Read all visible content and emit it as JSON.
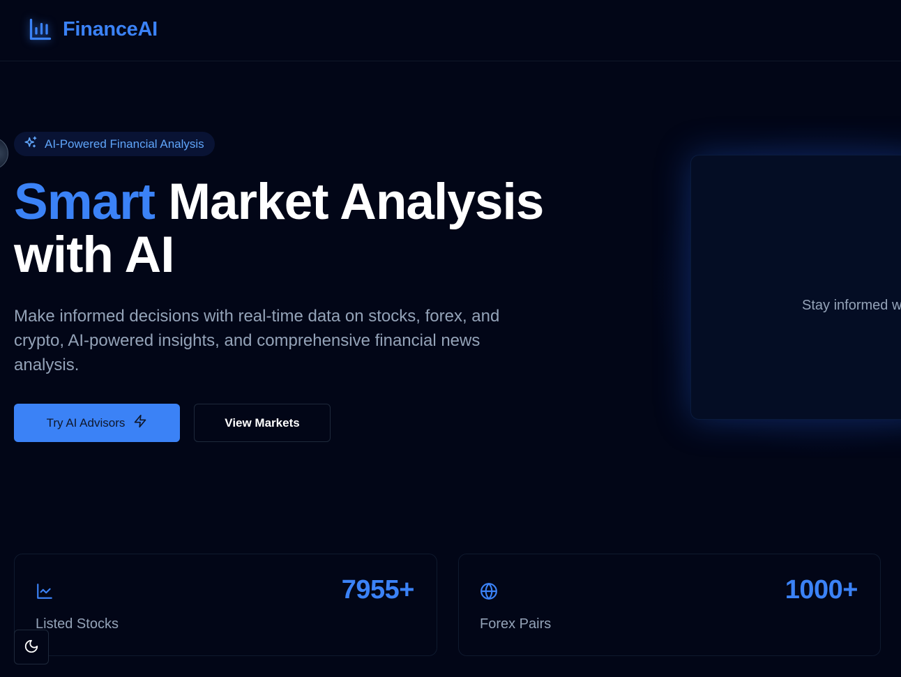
{
  "brand": {
    "name": "FinanceAI",
    "icon": "bar-chart-icon"
  },
  "hero": {
    "badge": {
      "icon": "sparkles-icon",
      "text": "AI-Powered Financial Analysis"
    },
    "title_accent": "Smart",
    "title_line1_rest": " Market Analysis",
    "title_line2": "with AI",
    "subtitle": "Make informed decisions with real-time data on stocks, forex, and crypto, AI-powered insights, and comprehensive financial news analysis.",
    "primary_button": {
      "label": "Try AI Advisors",
      "icon": "zap-icon"
    },
    "secondary_button": {
      "label": "View Markets"
    }
  },
  "preview_panel": {
    "text": "Stay informed w"
  },
  "stats": [
    {
      "icon": "line-chart-icon",
      "value": "7955+",
      "label": "Listed Stocks"
    },
    {
      "icon": "globe-icon",
      "value": "1000+",
      "label": "Forex Pairs"
    }
  ],
  "theme_toggle": {
    "icon": "moon-icon"
  },
  "colors": {
    "background": "#020617",
    "accent": "#3b82f6",
    "muted_text": "#94a3b8",
    "border": "#1e293b"
  }
}
